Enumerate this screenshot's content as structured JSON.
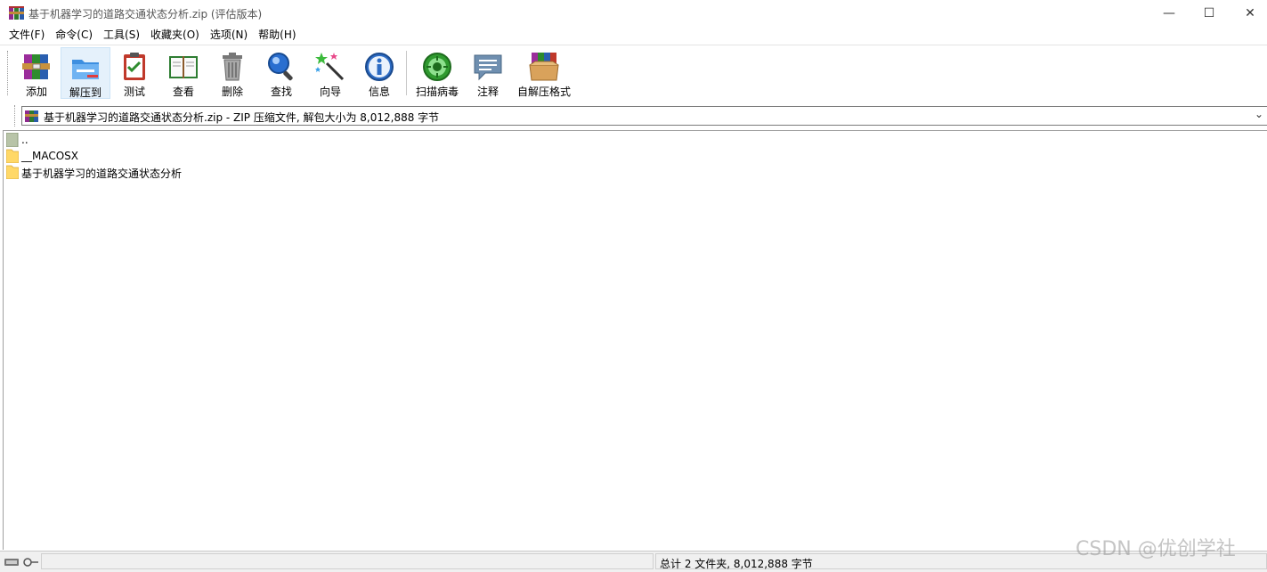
{
  "window": {
    "title": "基于机器学习的道路交通状态分析.zip (评估版本)",
    "controls": {
      "minimize": "—",
      "maximize": "☐",
      "close": "✕"
    }
  },
  "menu": [
    {
      "label": "文件(F)"
    },
    {
      "label": "命令(C)"
    },
    {
      "label": "工具(S)"
    },
    {
      "label": "收藏夹(O)"
    },
    {
      "label": "选项(N)"
    },
    {
      "label": "帮助(H)"
    }
  ],
  "toolbar": [
    {
      "label": "添加",
      "icon": "add-archive-icon"
    },
    {
      "label": "解压到",
      "icon": "extract-folder-icon",
      "active": true
    },
    {
      "label": "测试",
      "icon": "test-clipboard-icon"
    },
    {
      "label": "查看",
      "icon": "view-book-icon"
    },
    {
      "label": "删除",
      "icon": "trash-icon"
    },
    {
      "label": "查找",
      "icon": "magnifier-icon"
    },
    {
      "label": "向导",
      "icon": "wizard-wand-icon"
    },
    {
      "label": "信息",
      "icon": "info-icon"
    },
    {
      "label": "扫描病毒",
      "icon": "virus-scan-icon"
    },
    {
      "label": "注释",
      "icon": "comment-icon"
    },
    {
      "label": "自解压格式",
      "icon": "sfx-box-icon"
    }
  ],
  "address": {
    "text": "基于机器学习的道路交通状态分析.zip - ZIP 压缩文件, 解包大小为 8,012,888 字节"
  },
  "files": [
    {
      "name": "..",
      "type": "parent"
    },
    {
      "name": "__MACOSX",
      "type": "folder"
    },
    {
      "name": "基于机器学习的道路交通状态分析",
      "type": "folder"
    }
  ],
  "status": {
    "summary": "总计 2 文件夹, 8,012,888 字节"
  },
  "watermark": "CSDN @优创学社",
  "colors": {
    "active_tool_bg": "#e5f1fb",
    "folder": "#ffd867",
    "status_bg": "#f0f0f0"
  }
}
